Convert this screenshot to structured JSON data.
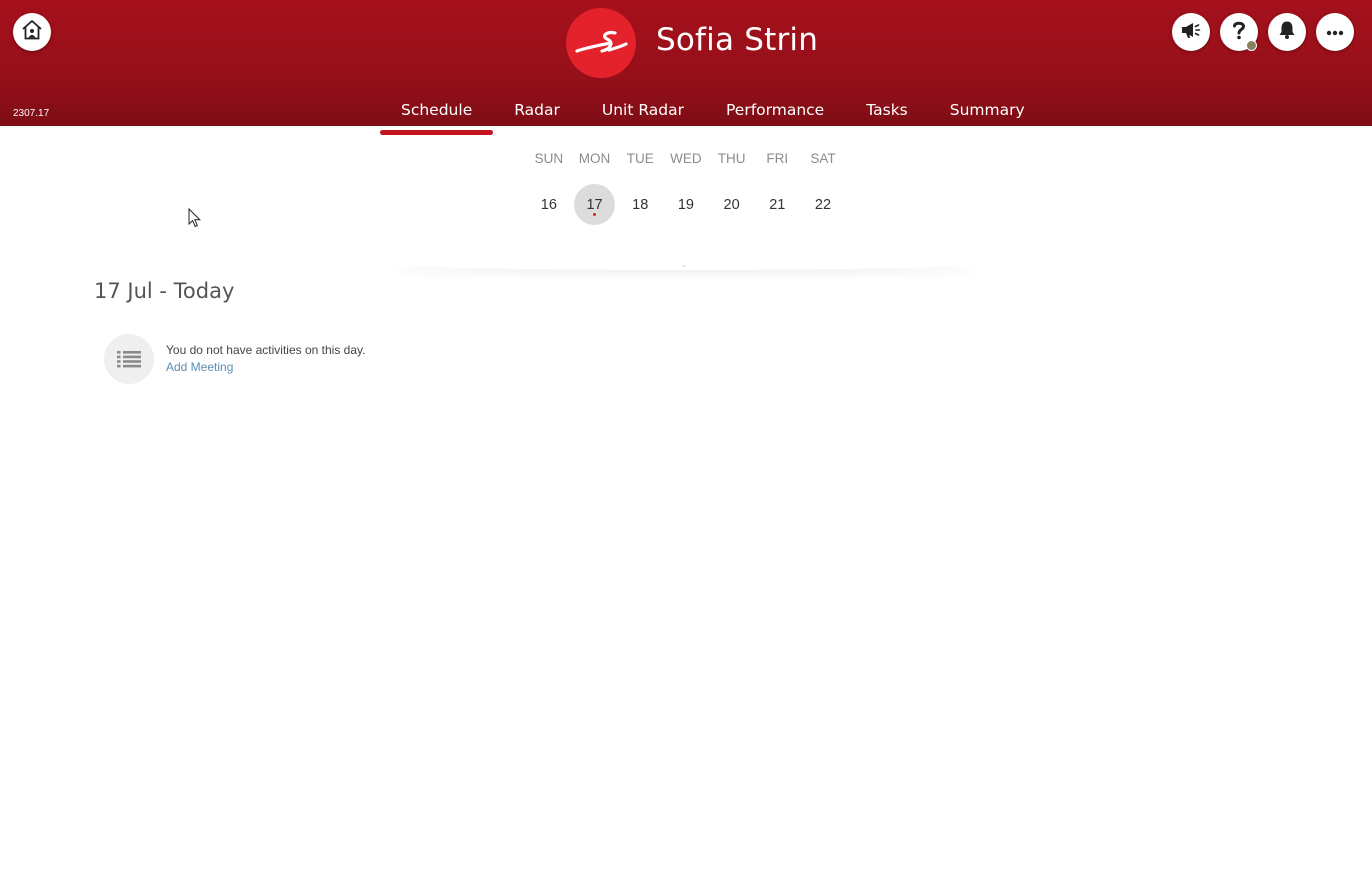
{
  "app": {
    "version": "2307.17",
    "user_name": "Sofia Strin",
    "logo_icon": "brand-logo-icon",
    "header_color": "#a5111c"
  },
  "top_icons": [
    {
      "name": "megaphone-icon"
    },
    {
      "name": "help-icon"
    },
    {
      "name": "bell-icon"
    },
    {
      "name": "more-icon"
    }
  ],
  "tabs": [
    {
      "label": "Schedule",
      "active": true
    },
    {
      "label": "Radar"
    },
    {
      "label": "Unit Radar"
    },
    {
      "label": "Performance"
    },
    {
      "label": "Tasks"
    },
    {
      "label": "Summary"
    }
  ],
  "week": {
    "days": [
      {
        "name": "SUN",
        "num": "16"
      },
      {
        "name": "MON",
        "num": "17",
        "selected": true
      },
      {
        "name": "TUE",
        "num": "18"
      },
      {
        "name": "WED",
        "num": "19"
      },
      {
        "name": "THU",
        "num": "20"
      },
      {
        "name": "FRI",
        "num": "21"
      },
      {
        "name": "SAT",
        "num": "22"
      }
    ]
  },
  "schedule": {
    "date_heading": "17 Jul - Today",
    "empty_message": "You do not have activities on this day.",
    "add_meeting": "Add Meeting"
  }
}
